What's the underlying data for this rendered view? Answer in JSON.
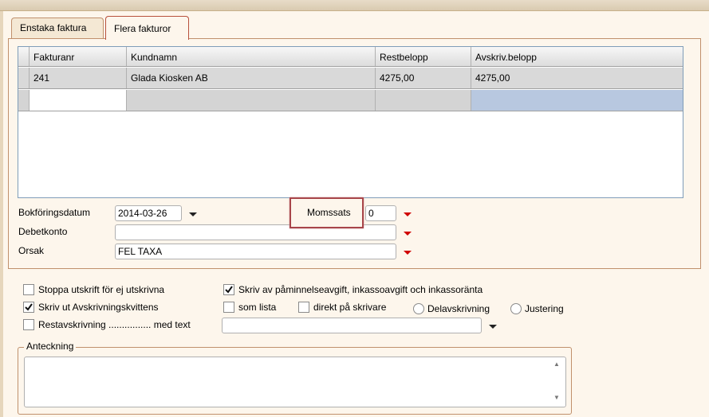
{
  "tabs": [
    {
      "label": "Enstaka faktura"
    },
    {
      "label": "Flera fakturor"
    }
  ],
  "grid": {
    "columns": [
      "Fakturanr",
      "Kundnamn",
      "Restbelopp",
      "Avskriv.belopp"
    ],
    "rows": [
      {
        "fakturanr": "241",
        "kundnamn": "Glada Kiosken AB",
        "restbelopp": "4275,00",
        "avskriv": "4275,00"
      }
    ]
  },
  "form": {
    "bokforingsdatum_label": "Bokföringsdatum",
    "bokforingsdatum_value": "2014-03-26",
    "momssats_label": "Momssats",
    "momssats_value": "0",
    "debetkonto_label": "Debetkonto",
    "debetkonto_value": "",
    "orsak_label": "Orsak",
    "orsak_value": "FEL TAXA"
  },
  "options": {
    "stoppa_label": "Stoppa utskrift för ej utskrivna",
    "skriv_ut_label": "Skriv ut Avskrivningskvittens",
    "restavskrivning_label": "Restavskrivning ................ med text",
    "skriv_av_label": "Skriv av påminnelseavgift, inkassoavgift och inkassoränta",
    "som_lista_label": "som lista",
    "direkt_label": "direkt på skrivare",
    "delavskrivning_label": "Delavskrivning",
    "justering_label": "Justering"
  },
  "anteckning": {
    "label": "Anteckning",
    "value": ""
  },
  "icons": {
    "dropdown_black": "chevron-down-icon",
    "dropdown_red": "red-triangle-icon",
    "checkmark": "check-icon"
  },
  "colors": {
    "accent_red": "#d00000",
    "highlight_box": "#a8454a",
    "grid_selected": "#b8c8e0"
  }
}
